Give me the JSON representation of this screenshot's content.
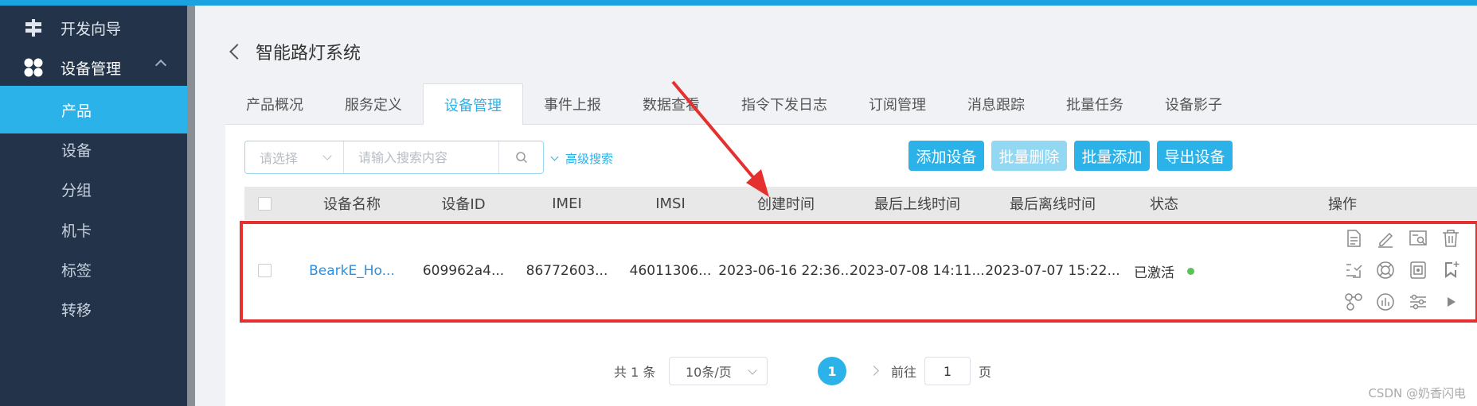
{
  "sidebar": {
    "items": [
      {
        "label": "开发向导",
        "icon": "signpost-icon"
      },
      {
        "label": "设备管理",
        "icon": "grid-icon"
      }
    ],
    "sub_items": [
      {
        "label": "产品",
        "active": true
      },
      {
        "label": "设备",
        "active": false
      },
      {
        "label": "分组",
        "active": false
      },
      {
        "label": "机卡",
        "active": false
      },
      {
        "label": "标签",
        "active": false
      },
      {
        "label": "转移",
        "active": false
      }
    ]
  },
  "header": {
    "title": "智能路灯系统"
  },
  "tabs": [
    {
      "label": "产品概况",
      "active": false
    },
    {
      "label": "服务定义",
      "active": false
    },
    {
      "label": "设备管理",
      "active": true
    },
    {
      "label": "事件上报",
      "active": false
    },
    {
      "label": "数据查看",
      "active": false
    },
    {
      "label": "指令下发日志",
      "active": false
    },
    {
      "label": "订阅管理",
      "active": false
    },
    {
      "label": "消息跟踪",
      "active": false
    },
    {
      "label": "批量任务",
      "active": false
    },
    {
      "label": "设备影子",
      "active": false
    }
  ],
  "search": {
    "select_placeholder": "请选择",
    "input_placeholder": "请输入搜索内容",
    "advanced_label": "高级搜索"
  },
  "actions": {
    "add": "添加设备",
    "batch_delete": "批量删除",
    "batch_add": "批量添加",
    "export": "导出设备"
  },
  "table": {
    "headers": [
      "设备名称",
      "设备ID",
      "IMEI",
      "IMSI",
      "创建时间",
      "最后上线时间",
      "最后离线时间",
      "状态",
      "操作"
    ],
    "rows": [
      {
        "name": "BearkE_Ho...",
        "device_id": "609962a4...",
        "imei": "86772603...",
        "imsi": "46011306...",
        "created": "2023-06-16 22:36...",
        "last_online": "2023-07-08 14:11...",
        "last_offline": "2023-07-07 15:22...",
        "status": "已激活"
      }
    ]
  },
  "pagination": {
    "total": "共 1 条",
    "page_size": "10条/页",
    "current": "1",
    "goto_prefix": "前往",
    "goto_value": "1",
    "goto_suffix": "页"
  },
  "watermark": "CSDN @奶香闪电",
  "colors": {
    "accent": "#2bb2e8",
    "sidebar_bg": "#23334a",
    "highlight_box": "#e53030",
    "status_active": "#5bc25b"
  }
}
